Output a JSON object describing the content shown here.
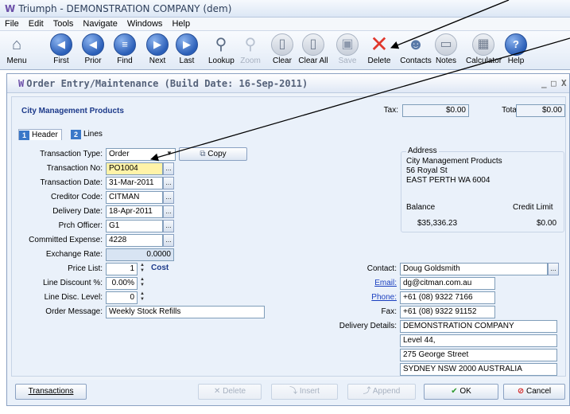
{
  "app": {
    "title": "Triumph - DEMONSTRATION COMPANY (dem)",
    "logo_glyph": "W"
  },
  "menu": [
    "File",
    "Edit",
    "Tools",
    "Navigate",
    "Windows",
    "Help"
  ],
  "toolbar": {
    "menu": "Menu",
    "first": "First",
    "prior": "Prior",
    "find": "Find",
    "next": "Next",
    "last": "Last",
    "lookup": "Lookup",
    "zoom": "Zoom",
    "clear": "Clear",
    "clear_all": "Clear All",
    "save": "Save",
    "delete": "Delete",
    "contacts": "Contacts",
    "notes": "Notes",
    "calculator": "Calculator",
    "help": "Help"
  },
  "window": {
    "title": "Order Entry/Maintenance (Build Date: 16-Sep-2011)",
    "minimize": "_",
    "maximize": "□",
    "close": "X"
  },
  "header": {
    "company": "City Management Products",
    "tax_label": "Tax:",
    "tax_value": "$0.00",
    "total_label": "Total:",
    "total_value": "$0.00"
  },
  "tabs": [
    {
      "num": "1",
      "label": "Header"
    },
    {
      "num": "2",
      "label": "Lines"
    }
  ],
  "form": {
    "transaction_type_label": "Transaction Type:",
    "transaction_type": "Order",
    "copy_label": "Copy",
    "transaction_no_label": "Transaction No:",
    "transaction_no": "PO1004",
    "transaction_date_label": "Transaction Date:",
    "transaction_date": "31-Mar-2011",
    "creditor_code_label": "Creditor Code:",
    "creditor_code": "CITMAN",
    "delivery_date_label": "Delivery Date:",
    "delivery_date": "18-Apr-2011",
    "prch_officer_label": "Prch Officer:",
    "prch_officer": "G1",
    "committed_expense_label": "Committed Expense:",
    "committed_expense": "4228",
    "exchange_rate_label": "Exchange Rate:",
    "exchange_rate": "0.0000",
    "price_list_label": "Price List:",
    "price_list": "1",
    "price_list_note": "Cost",
    "line_discount_label": "Line Discount %:",
    "line_discount": "0.00%",
    "line_disc_level_label": "Line Disc. Level:",
    "line_disc_level": "0",
    "order_message_label": "Order Message:",
    "order_message": "Weekly Stock Refills"
  },
  "address": {
    "legend": "Address",
    "lines": [
      "City Management Products",
      "56 Royal St",
      "EAST PERTH WA 6004"
    ],
    "balance_label": "Balance",
    "balance": "$35,336.23",
    "credit_limit_label": "Credit Limit",
    "credit_limit": "$0.00"
  },
  "contact": {
    "contact_label": "Contact:",
    "contact": "Doug Goldsmith",
    "email_label": "Email:",
    "email": "dg@citman.com.au",
    "phone_label": "Phone:",
    "phone": "+61 (08) 9322 7166",
    "fax_label": "Fax:",
    "fax": "+61 (08) 9322 91152",
    "delivery_label": "Delivery Details:",
    "delivery_lines": [
      "DEMONSTRATION COMPANY",
      "Level 44,",
      "275 George Street",
      "SYDNEY NSW 2000 AUSTRALIA"
    ]
  },
  "buttons": {
    "transactions": "Transactions",
    "delete": "Delete",
    "insert": "Insert",
    "append": "Append",
    "ok": "OK",
    "cancel": "Cancel"
  },
  "colors": {
    "accent_blue": "#2b5fb8",
    "delete_red": "#e0382d",
    "highlight": "#fff3a8",
    "ok_green": "#2e9a2e"
  }
}
